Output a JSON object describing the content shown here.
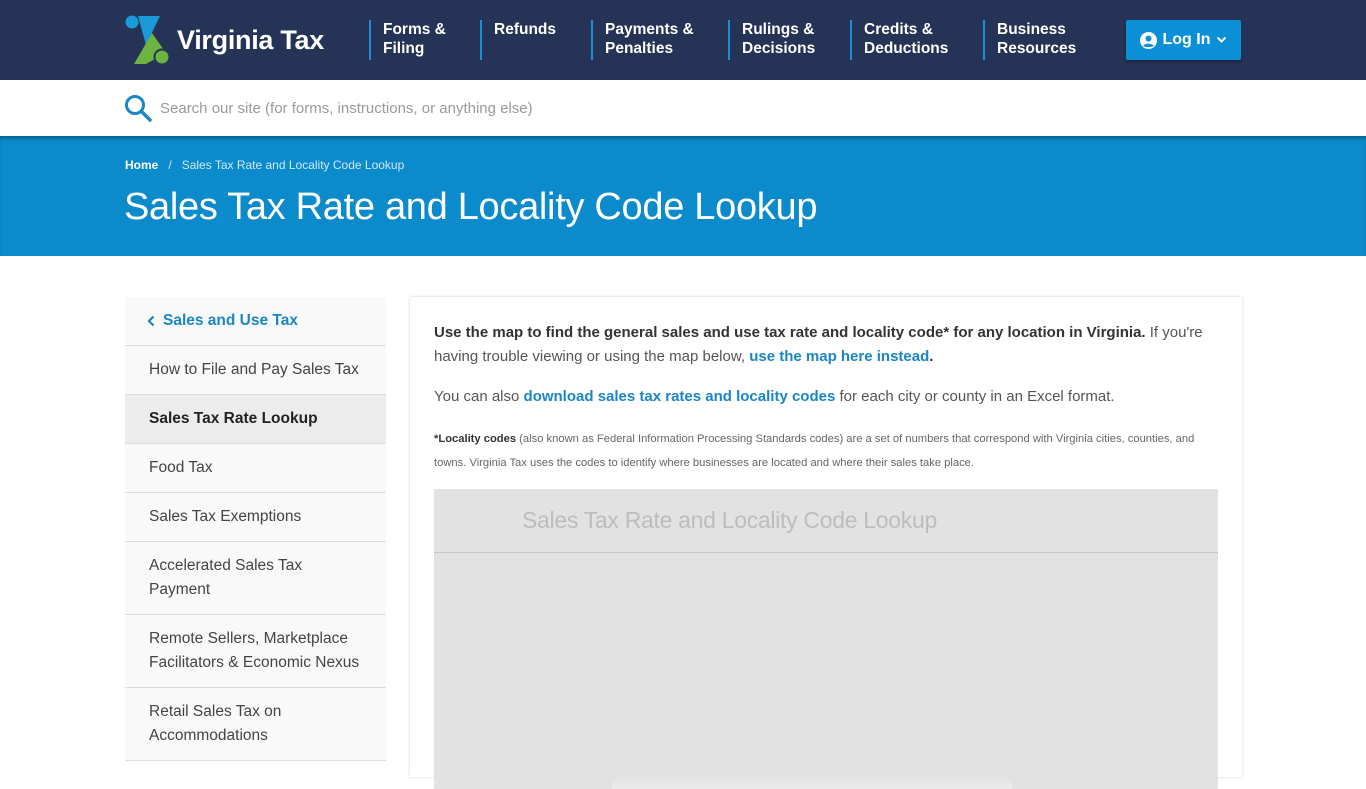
{
  "header": {
    "logo_text": "Virginia Tax",
    "nav": [
      {
        "line1": "Forms &",
        "line2": "Filing"
      },
      {
        "line1": "Refunds",
        "line2": ""
      },
      {
        "line1": "Payments &",
        "line2": "Penalties"
      },
      {
        "line1": "Rulings &",
        "line2": "Decisions"
      },
      {
        "line1": "Credits &",
        "line2": "Deductions"
      },
      {
        "line1": "Business",
        "line2": "Resources"
      }
    ],
    "login_label": "Log In"
  },
  "search": {
    "placeholder": "Search our site (for forms, instructions, or anything else)",
    "value": ""
  },
  "breadcrumb": {
    "home": "Home",
    "separator": "/",
    "current": "Sales Tax Rate and Locality Code Lookup"
  },
  "page_title": "Sales Tax Rate and Locality Code Lookup",
  "sidebar": {
    "parent": "Sales and Use Tax",
    "items": [
      {
        "label": "How to File and Pay Sales Tax",
        "active": false
      },
      {
        "label": "Sales Tax Rate Lookup",
        "active": true
      },
      {
        "label": "Food Tax",
        "active": false
      },
      {
        "label": "Sales Tax Exemptions",
        "active": false
      },
      {
        "label": "Accelerated Sales Tax Payment",
        "active": false
      },
      {
        "label": "Remote Sellers, Marketplace Facilitators & Economic Nexus",
        "active": false
      },
      {
        "label": "Retail Sales Tax on Accommodations",
        "active": false
      }
    ]
  },
  "content": {
    "intro_bold": "Use the map to find the general sales and use tax rate and locality code* for any location in Virginia.",
    "intro_rest": " If you're having trouble viewing or using the map below, ",
    "intro_link": "use the map here instead",
    "intro_end": ".",
    "also_prefix": "You can also ",
    "also_link": "download sales tax rates and locality codes",
    "also_suffix": " for each city or county in an Excel format.",
    "note_bold": "*Locality codes",
    "note_text": " (also known as Federal Information Processing Standards codes) are a set of numbers that correspond with Virginia cities, counties, and towns. Virginia Tax uses the codes to identify where businesses are located and where their sales take place."
  },
  "map": {
    "title": "Sales Tax Rate and Locality Code Lookup"
  },
  "colors": {
    "nav_bg": "#253356",
    "accent_blue": "#0b8bcb",
    "link": "#1a86c4",
    "logo_green": "#6cb33f",
    "logo_blue": "#1a9ad7"
  }
}
